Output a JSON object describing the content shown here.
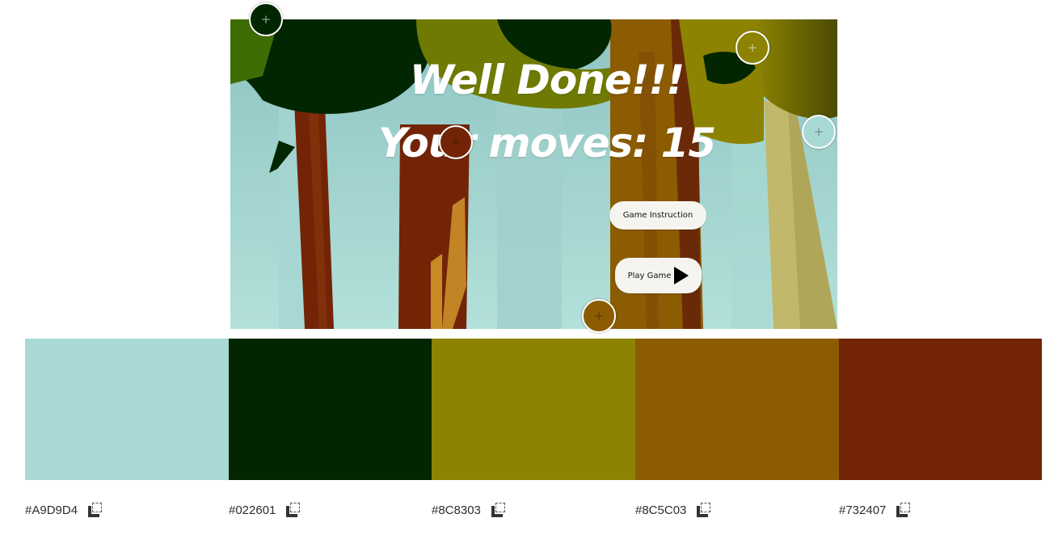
{
  "game": {
    "headline": "Well Done!!!",
    "moves_text": "Your moves: 15",
    "instructions_button": "Game Instruction",
    "play_button": "Play Game"
  },
  "markers": [
    {
      "name": "marker-dark-green",
      "color": "#022601",
      "icon": "plus-icon"
    },
    {
      "name": "marker-olive",
      "color": "#8C8303",
      "icon": "plus-icon"
    },
    {
      "name": "marker-light-teal",
      "color": "#A9D9D4",
      "icon": "plus-icon"
    },
    {
      "name": "marker-rust",
      "color": "#732407",
      "icon": "plus-icon"
    },
    {
      "name": "marker-brown",
      "color": "#8C5C03",
      "icon": "plus-icon"
    }
  ],
  "palette": [
    {
      "hex": "#A9D9D4",
      "label": "#A9D9D4"
    },
    {
      "hex": "#022601",
      "label": "#022601"
    },
    {
      "hex": "#8C8303",
      "label": "#8C8303"
    },
    {
      "hex": "#8C5C03",
      "label": "#8C5C03"
    },
    {
      "hex": "#732407",
      "label": "#732407"
    }
  ],
  "copy_icon": "copy-icon"
}
